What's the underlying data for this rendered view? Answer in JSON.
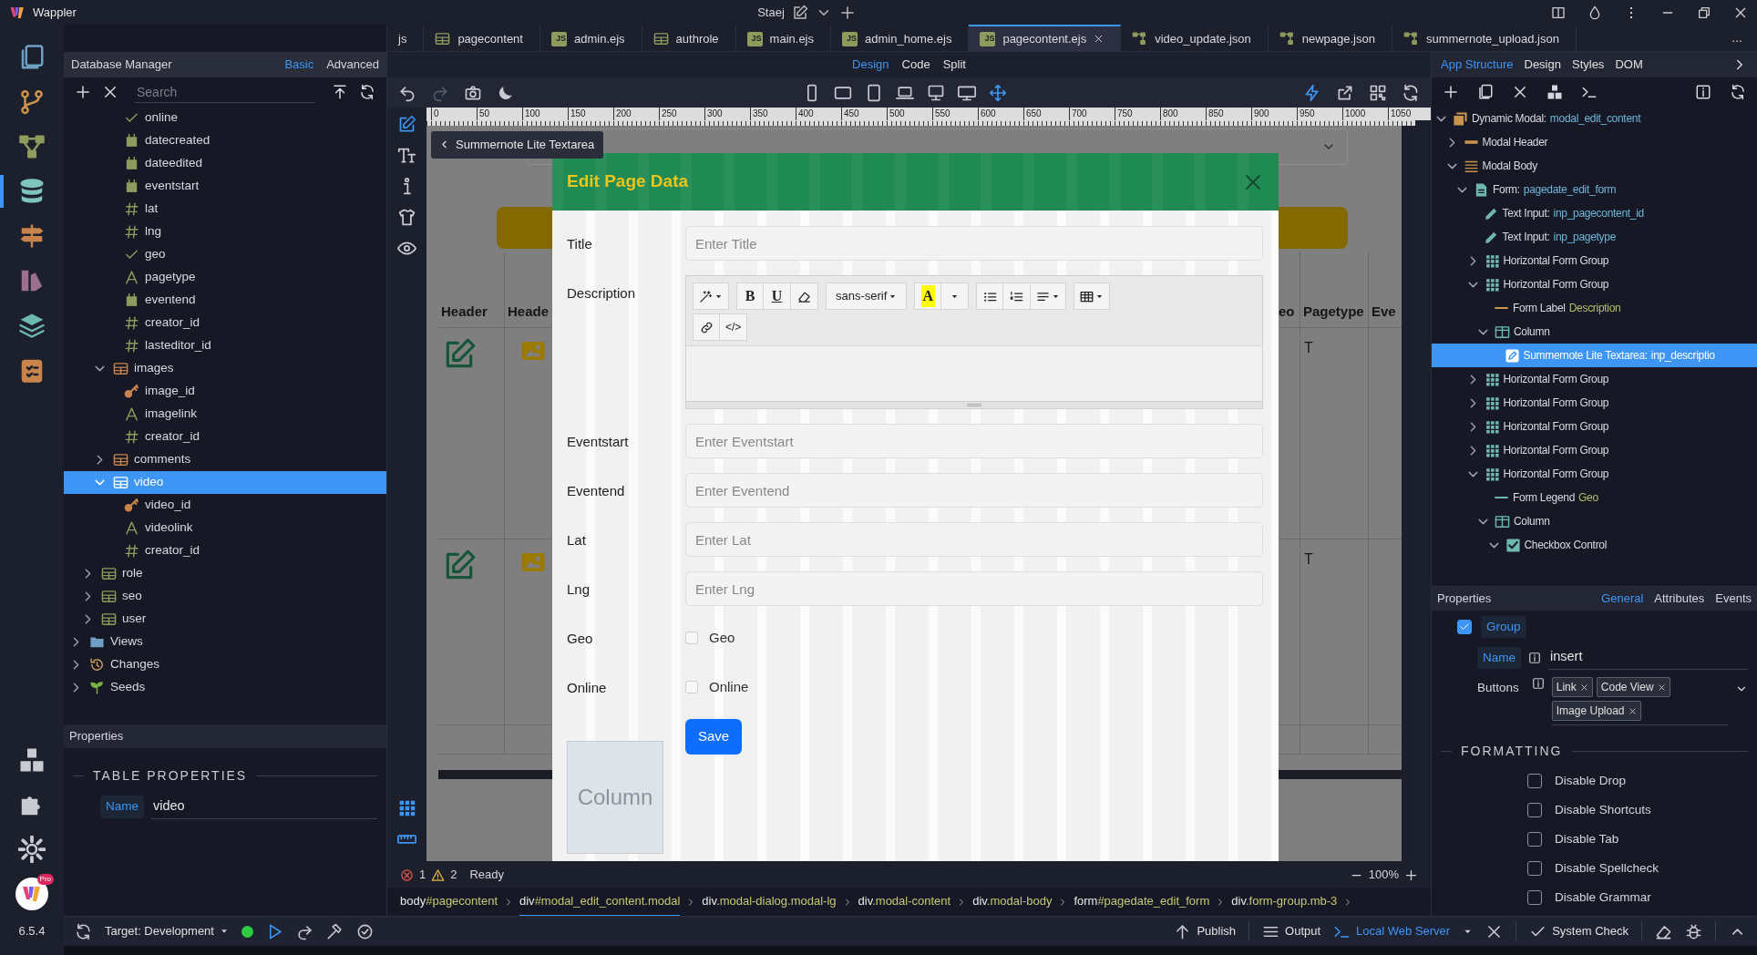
{
  "titlebar": {
    "app": "Wappler",
    "project": "Staej"
  },
  "rail": [
    {
      "kind": "pages",
      "selected": false
    },
    {
      "kind": "branch",
      "selected": false
    },
    {
      "kind": "flow",
      "selected": false
    },
    {
      "kind": "database",
      "selected": true
    },
    {
      "kind": "signpost",
      "selected": false
    },
    {
      "kind": "palette",
      "selected": false
    },
    {
      "kind": "layers",
      "selected": false
    },
    {
      "kind": "clipboard",
      "selected": false
    }
  ],
  "rail_bottom": [
    {
      "kind": "boxes"
    },
    {
      "kind": "puzzle"
    },
    {
      "kind": "gear"
    }
  ],
  "account": {
    "badge": "Pro"
  },
  "version": "6.5.4",
  "database_manager": {
    "title": "Database Manager",
    "modes": [
      {
        "label": "Basic",
        "selected": true
      },
      {
        "label": "Advanced",
        "selected": false
      }
    ],
    "search": {
      "placeholder": "Search"
    },
    "tree": [
      {
        "children": [
          {
            "children": [
              {
                "children": [
                  {
                    "kind": "check",
                    "label": "online",
                    "selected": false
                  },
                  {
                    "kind": "date",
                    "label": "datecreated",
                    "selected": false
                  },
                  {
                    "kind": "date",
                    "label": "dateedited",
                    "selected": false
                  },
                  {
                    "kind": "date",
                    "label": "eventstart",
                    "selected": false
                  },
                  {
                    "kind": "number",
                    "label": "lat",
                    "selected": false
                  },
                  {
                    "kind": "number",
                    "label": "lng",
                    "selected": false
                  },
                  {
                    "kind": "check",
                    "label": "geo",
                    "selected": false
                  },
                  {
                    "kind": "text",
                    "label": "pagetype",
                    "selected": false
                  },
                  {
                    "kind": "date",
                    "label": "eventend",
                    "selected": false
                  },
                  {
                    "kind": "number",
                    "label": "creator_id",
                    "selected": false
                  },
                  {
                    "kind": "number",
                    "label": "lasteditor_id",
                    "selected": false
                  }
                ]
              },
              {
                "kind": "table",
                "label": "images",
                "color": "#c8844c",
                "expanded": true,
                "selected": false,
                "children": [
                  {
                    "kind": "key",
                    "label": "image_id",
                    "selected": false
                  },
                  {
                    "kind": "text",
                    "label": "imagelink",
                    "selected": false
                  },
                  {
                    "kind": "number",
                    "label": "creator_id",
                    "selected": false
                  }
                ]
              },
              {
                "kind": "table",
                "label": "comments",
                "color": "#c8844c",
                "expanded": false,
                "selected": false
              },
              {
                "kind": "table",
                "label": "video",
                "expanded": true,
                "selected": true,
                "children": [
                  {
                    "kind": "key",
                    "label": "video_id",
                    "selected": false
                  },
                  {
                    "kind": "text",
                    "label": "videolink",
                    "selected": false
                  },
                  {
                    "kind": "number",
                    "label": "creator_id",
                    "selected": false
                  }
                ]
              }
            ]
          },
          {
            "kind": "table",
            "label": "role",
            "color": "#8d9b5c",
            "expanded": false,
            "selected": false
          },
          {
            "kind": "table",
            "label": "seo",
            "color": "#8d9b5c",
            "expanded": false,
            "selected": false
          },
          {
            "kind": "table",
            "label": "user",
            "color": "#8d9b5c",
            "expanded": false,
            "selected": false
          }
        ]
      },
      {
        "kind": "folder",
        "label": "Views",
        "expanded": false,
        "selected": false
      },
      {
        "kind": "history",
        "label": "Changes",
        "expanded": false,
        "selected": false
      },
      {
        "kind": "seed",
        "label": "Seeds",
        "expanded": false,
        "selected": false
      }
    ]
  },
  "left_properties": {
    "title": "Properties",
    "section": "TABLE PROPERTIES",
    "fields": [
      {
        "label": "Name",
        "value": "video",
        "highlighted": true
      }
    ]
  },
  "tabs": [
    {
      "kind": "plain",
      "label": "js",
      "selected": false
    },
    {
      "kind": "table",
      "label": "pagecontent",
      "selected": false
    },
    {
      "kind": "js",
      "badge": "JS",
      "label": "admin.ejs",
      "selected": false
    },
    {
      "kind": "table",
      "label": "authrole",
      "selected": false
    },
    {
      "kind": "js",
      "badge": "JS",
      "label": "main.ejs",
      "selected": false
    },
    {
      "kind": "js",
      "badge": "JS",
      "label": "admin_home.ejs",
      "selected": false
    },
    {
      "kind": "js",
      "badge": "JS",
      "label": "pagecontent.ejs",
      "selected": true
    },
    {
      "kind": "json",
      "label": "video_update.json",
      "selected": false
    },
    {
      "kind": "json",
      "label": "newpage.json",
      "selected": false
    },
    {
      "kind": "json",
      "label": "summernote_upload.json",
      "selected": false
    }
  ],
  "tabs_overflow": "...",
  "view_modes": [
    {
      "label": "Design",
      "selected": true
    },
    {
      "label": "Code",
      "selected": false
    },
    {
      "label": "Split",
      "selected": false
    }
  ],
  "toolbar": {
    "left": [
      {
        "kind": "undo",
        "disabled": false
      },
      {
        "kind": "redo",
        "disabled": true
      },
      {
        "kind": "camera",
        "disabled": false
      },
      {
        "kind": "moon",
        "disabled": false
      }
    ],
    "devices": [
      {
        "kind": "phone",
        "selected": false
      },
      {
        "kind": "tabletwide",
        "selected": false
      },
      {
        "kind": "tablet",
        "selected": false
      },
      {
        "kind": "laptop",
        "selected": false
      },
      {
        "kind": "desktop",
        "selected": false
      },
      {
        "kind": "widescreen",
        "selected": false
      },
      {
        "kind": "move",
        "selected": true
      }
    ],
    "right": [
      {
        "kind": "bolt"
      },
      {
        "kind": "share"
      },
      {
        "kind": "qr"
      },
      {
        "kind": "refresh"
      }
    ]
  },
  "ruler": [
    "0",
    "50",
    "100",
    "150",
    "200",
    "250",
    "300",
    "350",
    "400",
    "450",
    "500",
    "550",
    "600",
    "650",
    "700",
    "750",
    "800",
    "850",
    "900",
    "950",
    "1000",
    "1050"
  ],
  "tool_strip": [
    {
      "kind": "edit",
      "selected": true
    },
    {
      "kind": "textsize",
      "selected": false
    },
    {
      "kind": "info",
      "selected": false
    },
    {
      "kind": "shirt",
      "selected": false
    },
    {
      "kind": "eye",
      "selected": false
    }
  ],
  "tool_strip_bottom": [
    {
      "kind": "grid"
    },
    {
      "kind": "ruler"
    }
  ],
  "canvas": {
    "crumb": "Summernote Lite Textarea",
    "headers": [
      "Header",
      "Heade",
      "eo",
      "Pagetype",
      "Eve"
    ],
    "rows": [
      {
        "pagetype": "T"
      },
      {
        "pagetype": "T"
      }
    ],
    "modal": {
      "title": "Edit Page Data",
      "fields": [
        {
          "kind": "text",
          "label": "Title",
          "placeholder": "Enter Title"
        },
        {
          "kind": "editor",
          "label": "Description"
        },
        {
          "kind": "text",
          "label": "Eventstart",
          "placeholder": "Enter Eventstart"
        },
        {
          "kind": "text",
          "label": "Eventend",
          "placeholder": "Enter Eventend"
        },
        {
          "kind": "text",
          "label": "Lat",
          "placeholder": "Enter Lat"
        },
        {
          "kind": "text",
          "label": "Lng",
          "placeholder": "Enter Lng"
        },
        {
          "kind": "checkbox",
          "label": "Geo",
          "text": "Geo",
          "checked": false
        },
        {
          "kind": "checkbox",
          "label": "Online",
          "text": "Online",
          "checked": false
        }
      ],
      "editor": {
        "rows": [
          [
            [
              {
                "kind": "magic",
                "caret": true
              }
            ],
            [
              {
                "kind": "bold",
                "text": "B"
              },
              {
                "kind": "underline",
                "text": "U"
              },
              {
                "kind": "eraser"
              }
            ],
            [
              {
                "kind": "font",
                "text": "sans-serif",
                "caret": true
              }
            ],
            [
              {
                "kind": "color",
                "text": "A"
              },
              {
                "kind": "more",
                "caret": true
              }
            ],
            [
              {
                "kind": "ul"
              },
              {
                "kind": "ol"
              },
              {
                "kind": "align",
                "caret": true
              }
            ],
            [
              {
                "kind": "tablegrid",
                "caret": true
              }
            ]
          ],
          [
            [
              {
                "kind": "link"
              },
              {
                "kind": "code",
                "text": "</>"
              }
            ]
          ]
        ]
      },
      "save": "Save",
      "column": "Column"
    }
  },
  "status": {
    "errors": "1",
    "warnings": "2",
    "text": "Ready",
    "zoom": "100%"
  },
  "breadcrumbs": [
    {
      "tag": "body",
      "rest": "#pagecontent",
      "selected": false
    },
    {
      "tag": "div",
      "rest": "#modal_edit_content.modal",
      "selected": true
    },
    {
      "tag": "div",
      "rest": ".modal-dialog.modal-lg",
      "selected": false
    },
    {
      "tag": "div",
      "rest": ".modal-content",
      "selected": false
    },
    {
      "tag": "div",
      "rest": ".modal-body",
      "selected": false
    },
    {
      "tag": "form",
      "rest": "#pagedate_edit_form",
      "selected": false
    },
    {
      "tag": "div",
      "rest": ".form-group.mb-3",
      "selected": false
    }
  ],
  "structure": {
    "tabs": [
      {
        "label": "App Structure",
        "selected": true
      },
      {
        "label": "Design",
        "selected": false
      },
      {
        "label": "Styles",
        "selected": false
      },
      {
        "label": "DOM",
        "selected": false
      }
    ],
    "tree": [
      {
        "kind": "modal",
        "label": "Dynamic Modal:",
        "value": "modal_edit_content",
        "expanded": true,
        "selected": false,
        "children": [
          {
            "kind": "header",
            "label": "Modal Header",
            "expanded": false,
            "selected": false
          },
          {
            "kind": "body",
            "label": "Modal Body",
            "expanded": true,
            "selected": false,
            "children": [
              {
                "kind": "form",
                "label": "Form:",
                "value": "pagedate_edit_form",
                "expanded": true,
                "selected": false,
                "children": [
                  {
                    "kind": "pencil",
                    "label": "Text Input:",
                    "value": "inp_pagecontent_id",
                    "selected": false
                  },
                  {
                    "kind": "pencil",
                    "label": "Text Input:",
                    "value": "inp_pagetype",
                    "selected": false
                  },
                  {
                    "kind": "grid",
                    "label": "Horizontal Form Group",
                    "expanded": false,
                    "selected": false
                  },
                  {
                    "kind": "grid",
                    "label": "Horizontal Form Group",
                    "expanded": true,
                    "selected": false,
                    "children": [
                      {
                        "kind": "label",
                        "label": "Form Label",
                        "value": "Description",
                        "selected": false
                      },
                      {
                        "kind": "column",
                        "label": "Column",
                        "expanded": true,
                        "selected": false,
                        "children": [
                          {
                            "kind": "textarea",
                            "label": "Summernote Lite Textarea:",
                            "value": "inp_descriptio",
                            "selected": true
                          }
                        ]
                      }
                    ]
                  },
                  {
                    "kind": "grid",
                    "label": "Horizontal Form Group",
                    "expanded": false,
                    "selected": false
                  },
                  {
                    "kind": "grid",
                    "label": "Horizontal Form Group",
                    "expanded": false,
                    "selected": false
                  },
                  {
                    "kind": "grid",
                    "label": "Horizontal Form Group",
                    "expanded": false,
                    "selected": false
                  },
                  {
                    "kind": "grid",
                    "label": "Horizontal Form Group",
                    "expanded": false,
                    "selected": false
                  },
                  {
                    "kind": "grid",
                    "label": "Horizontal Form Group",
                    "expanded": true,
                    "selected": false,
                    "children": [
                      {
                        "kind": "legend",
                        "label": "Form Legend",
                        "value": "Geo",
                        "selected": false
                      },
                      {
                        "kind": "column",
                        "label": "Column",
                        "expanded": true,
                        "selected": false,
                        "children": [
                          {
                            "kind": "checkbox",
                            "label": "Checkbox Control",
                            "expanded": true,
                            "selected": false
                          }
                        ]
                      }
                    ]
                  }
                ]
              }
            ]
          }
        ]
      }
    ]
  },
  "properties": {
    "title": "Properties",
    "tabs": [
      {
        "label": "General",
        "selected": true
      },
      {
        "label": "Attributes",
        "selected": false
      },
      {
        "label": "Events",
        "selected": false
      }
    ],
    "group": {
      "label": "Group",
      "checked": true
    },
    "name": {
      "label": "Name",
      "value": "insert",
      "highlighted": true
    },
    "buttons": {
      "label": "Buttons",
      "highlighted": false,
      "tags": [
        "Link",
        "Code View",
        "Image Upload"
      ]
    },
    "section": "FORMATTING",
    "options": [
      {
        "label": "Disable Drop",
        "checked": false
      },
      {
        "label": "Disable Shortcuts",
        "checked": false
      },
      {
        "label": "Disable Tab",
        "checked": false
      },
      {
        "label": "Disable Spellcheck",
        "checked": false
      },
      {
        "label": "Disable Grammar",
        "checked": false
      }
    ]
  },
  "bottom_bar": {
    "target": "Target: Development",
    "running": true,
    "publish": "Publish",
    "output": "Output",
    "server": "Local Web Server",
    "system_check": "System Check"
  }
}
